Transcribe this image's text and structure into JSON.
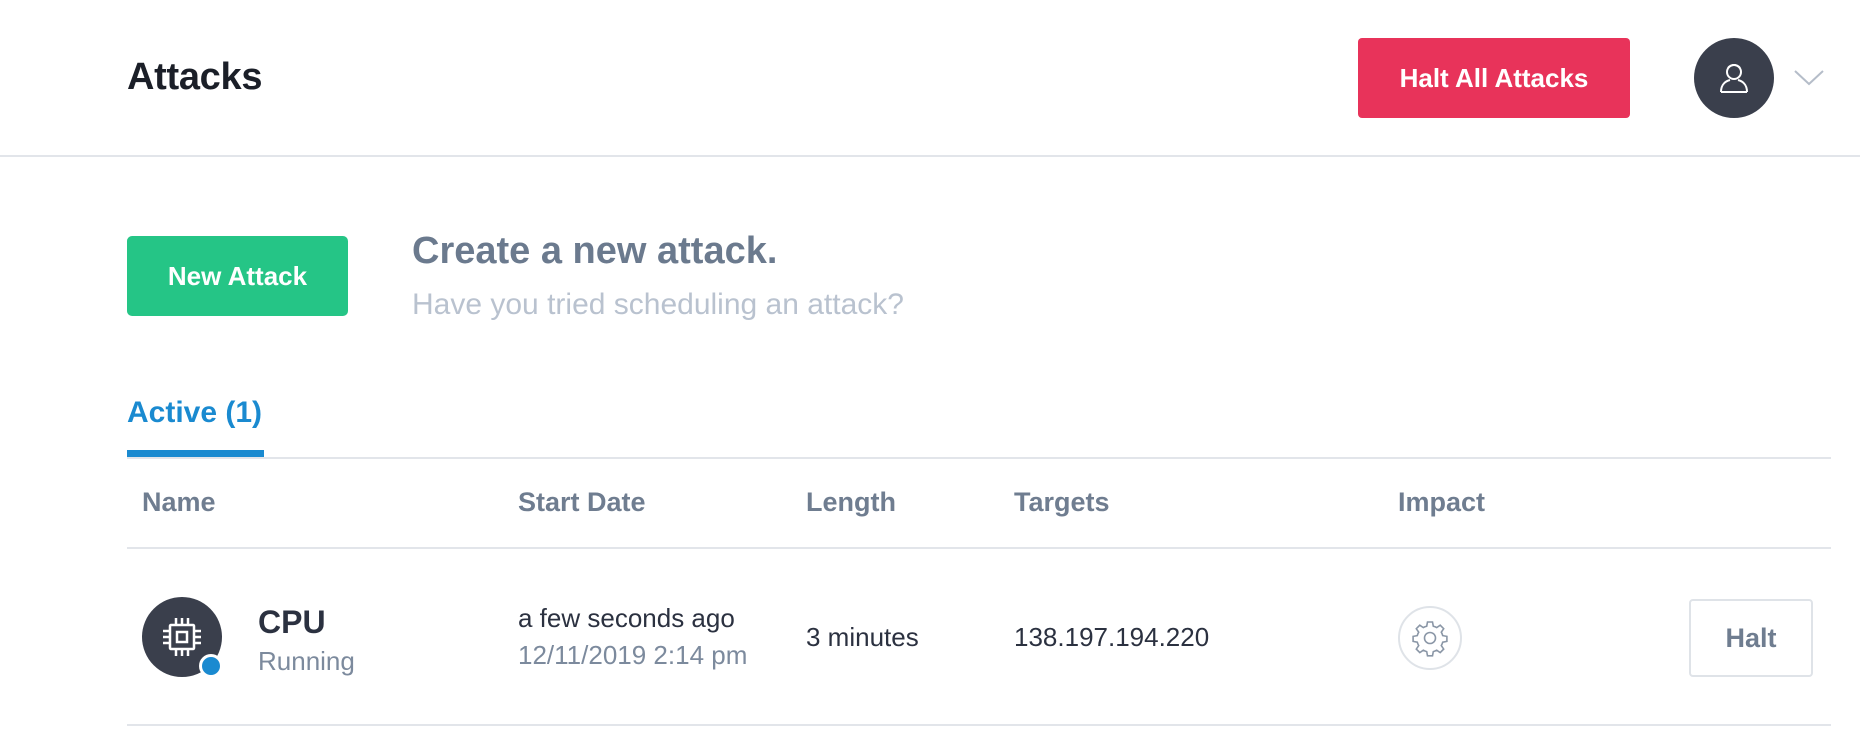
{
  "header": {
    "title": "Attacks",
    "halt_all_label": "Halt All Attacks"
  },
  "promo": {
    "new_attack_label": "New Attack",
    "title": "Create a new attack.",
    "subtitle": "Have you tried scheduling an attack?"
  },
  "tabs": [
    {
      "label": "Active (1)",
      "selected": true
    }
  ],
  "table": {
    "columns": [
      "Name",
      "Start Date",
      "Length",
      "Targets",
      "Impact"
    ],
    "rows": [
      {
        "name": "CPU",
        "status": "Running",
        "start_relative": "a few seconds ago",
        "start_absolute": "12/11/2019 2:14 pm",
        "length": "3 minutes",
        "targets": "138.197.194.220",
        "impact_icon": "gear-icon",
        "halt_label": "Halt"
      }
    ]
  },
  "icons": {
    "avatar": "user-icon",
    "menu": "chevron-down-icon",
    "row": "cpu-icon"
  },
  "colors": {
    "danger": "#e8335a",
    "success": "#25c586",
    "accent": "#1a8ad0",
    "dark": "#3a3f4c"
  }
}
